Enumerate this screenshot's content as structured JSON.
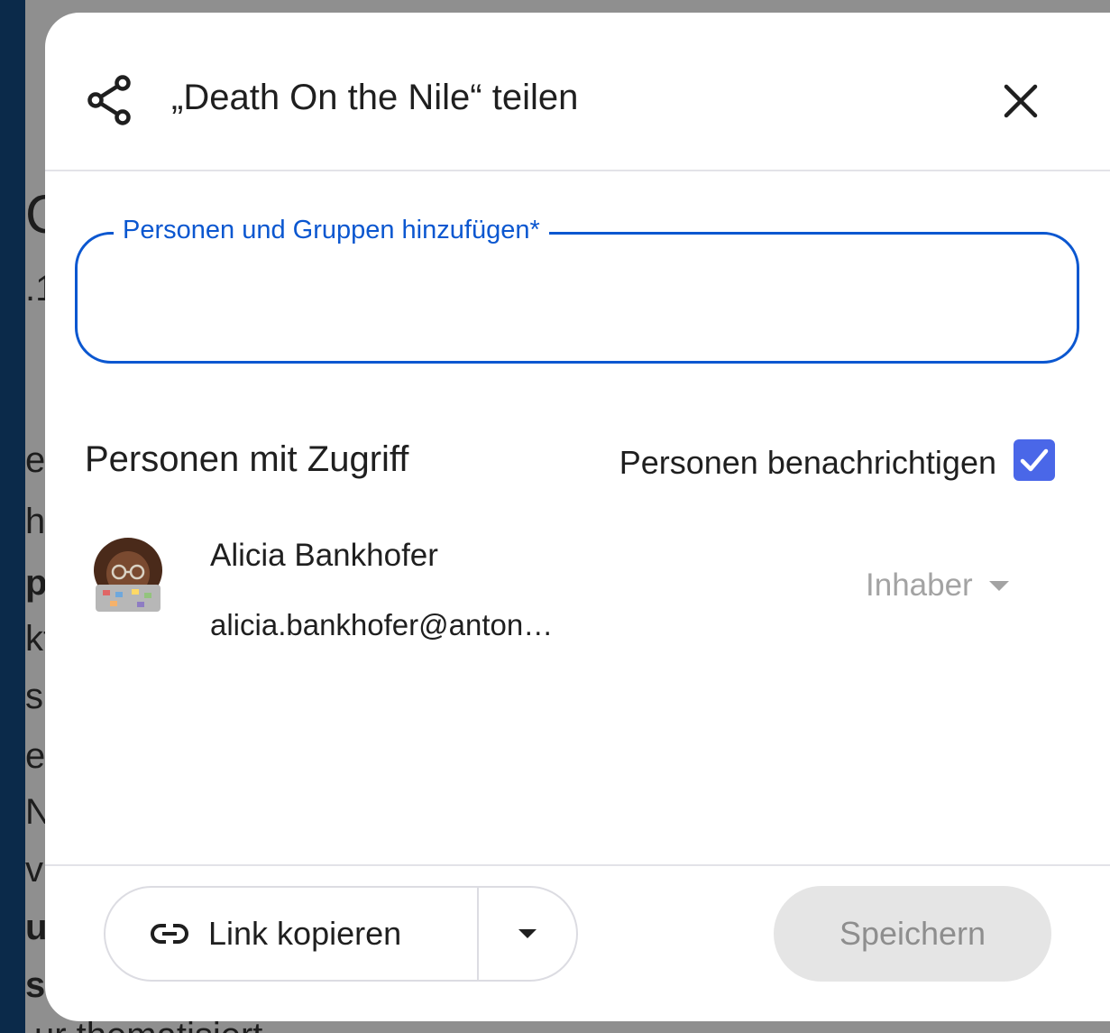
{
  "background_doc": {
    "fragments": [
      {
        "id": "f1",
        "text": "C",
        "bold": false
      },
      {
        "id": "f2",
        "text": ".1",
        "bold": false
      },
      {
        "id": "f3",
        "text": "er",
        "bold": false
      },
      {
        "id": "f4",
        "text": "hi",
        "bold": false
      },
      {
        "id": "f5",
        "text": "p",
        "bold": true
      },
      {
        "id": "f6",
        "text": "kt",
        "bold": false
      },
      {
        "id": "f7",
        "text": "s",
        "bold": false
      },
      {
        "id": "f8",
        "text": "er",
        "bold": false
      },
      {
        "id": "f9",
        "text": "N",
        "bold": false
      },
      {
        "id": "f10",
        "text": "vi",
        "bold": false
      },
      {
        "id": "f11",
        "text": "u",
        "bold": true
      },
      {
        "id": "f12",
        "text": "sc",
        "bold": true
      },
      {
        "id": "f13",
        "text": "ur thematisiert",
        "bold": false
      }
    ]
  },
  "dialog": {
    "title": "„Death On the Nile“ teilen",
    "share_icon": "share-icon",
    "close_icon": "close-icon",
    "add_people": {
      "label": "Personen und Gruppen hinzufügen*",
      "value": ""
    },
    "access": {
      "title": "Personen mit Zugriff",
      "notify_label": "Personen benachrichtigen",
      "notify_checked": true,
      "people": [
        {
          "name": "Alicia Bankhofer",
          "email": "alicia.bankhofer@anton…",
          "role": "Inhaber",
          "avatar_icon": "memoji-avatar"
        }
      ]
    },
    "footer": {
      "copy_link_label": "Link kopieren",
      "copy_link_icon": "link-icon",
      "more_icon": "caret-down-icon",
      "save_label": "Speichern"
    }
  },
  "colors": {
    "accent": "#0b57d0",
    "checkbox": "#4a67e8",
    "backdrop": "#0b2a4a",
    "dimmed_doc": "#8f8f8f"
  }
}
